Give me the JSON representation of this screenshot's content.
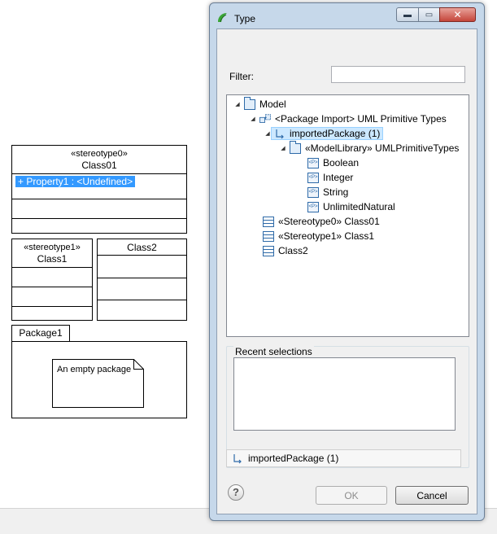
{
  "diagram": {
    "class01": {
      "stereotype": "«stereotype0»",
      "name": "Class01",
      "property": "+ Property1 : <Undefined>"
    },
    "class1": {
      "stereotype": "«stereotype1»",
      "name": "Class1"
    },
    "class2": {
      "name": "Class2"
    },
    "package1": {
      "name": "Package1",
      "note": "An empty package"
    }
  },
  "dialog": {
    "title": "Type",
    "filter_label": "Filter:",
    "filter_value": "",
    "tree": [
      {
        "label": "Model",
        "icon": "package-icon",
        "toggle": "◢"
      },
      {
        "label": "<Package Import> UML Primitive Types",
        "icon": "package-import-icon",
        "toggle": "◢"
      },
      {
        "label": "importedPackage (1)",
        "icon": "element-import-arrow-icon",
        "toggle": "◢",
        "selected": true
      },
      {
        "label": "«ModelLibrary» UMLPrimitiveTypes",
        "icon": "package-icon",
        "toggle": "◢"
      },
      {
        "label": "Boolean",
        "icon": "primitive-type-icon"
      },
      {
        "label": "Integer",
        "icon": "primitive-type-icon"
      },
      {
        "label": "String",
        "icon": "primitive-type-icon"
      },
      {
        "label": "UnlimitedNatural",
        "icon": "primitive-type-icon"
      },
      {
        "label": "«Stereotype0» Class01",
        "icon": "class-icon"
      },
      {
        "label": "«Stereotype1» Class1",
        "icon": "class-icon"
      },
      {
        "label": "Class2",
        "icon": "class-icon"
      }
    ],
    "recent_label": "Recent selections",
    "status_text": "importedPackage (1)",
    "help_symbol": "?",
    "ok_label": "OK",
    "cancel_label": "Cancel",
    "window_buttons": {
      "minimize": "▬",
      "maximize": "▭",
      "close": "✕"
    }
  }
}
